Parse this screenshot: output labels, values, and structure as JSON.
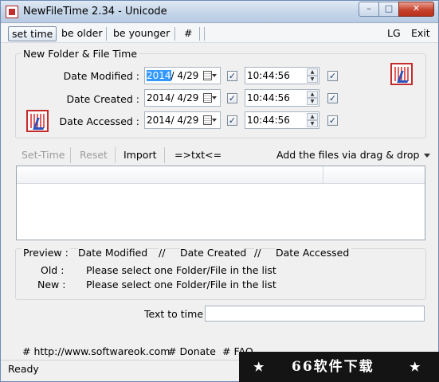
{
  "window": {
    "title": "NewFileTime 2.34 - Unicode",
    "controls": {
      "minimize": "–",
      "maximize": "□",
      "close": "✕"
    }
  },
  "menu": {
    "set_time": "set time",
    "be_older": "be older",
    "be_younger": "be younger",
    "hash": "#",
    "lg": "LG",
    "exit": "Exit"
  },
  "group": {
    "title": "New Folder & File Time",
    "rows": [
      {
        "label": "Date Modified :",
        "date_year": "2014",
        "date_rest": "/  4/29",
        "time": "10:44:56"
      },
      {
        "label": "Date Created :",
        "date_year": "2014",
        "date_rest": "/  4/29",
        "time": "10:44:56"
      },
      {
        "label": "Date Accessed :",
        "date_year": "2014",
        "date_rest": "/  4/29",
        "time": "10:44:56"
      }
    ]
  },
  "toolbar": {
    "set_time": "Set-Time",
    "reset": "Reset",
    "import": "Import",
    "txt": "=>txt<=",
    "drag_drop": "Add the files via drag & drop"
  },
  "preview": {
    "label": "Preview :",
    "date_modified": "Date Modified",
    "sep1": "//",
    "date_created": "Date Created",
    "sep2": "//",
    "date_accessed": "Date Accessed",
    "old_label": "Old :",
    "old_value": "Please select one Folder/File in the list",
    "new_label": "New :",
    "new_value": "Please select one Folder/File in the list"
  },
  "text_to_time": {
    "label": "Text to time",
    "value": ""
  },
  "links": {
    "website": "# http://www.softwareok.com",
    "donate": "# Donate",
    "faq": "# FAQ"
  },
  "status": {
    "text": "Ready"
  },
  "watermark": {
    "text": "66软件下载",
    "star": "★"
  }
}
